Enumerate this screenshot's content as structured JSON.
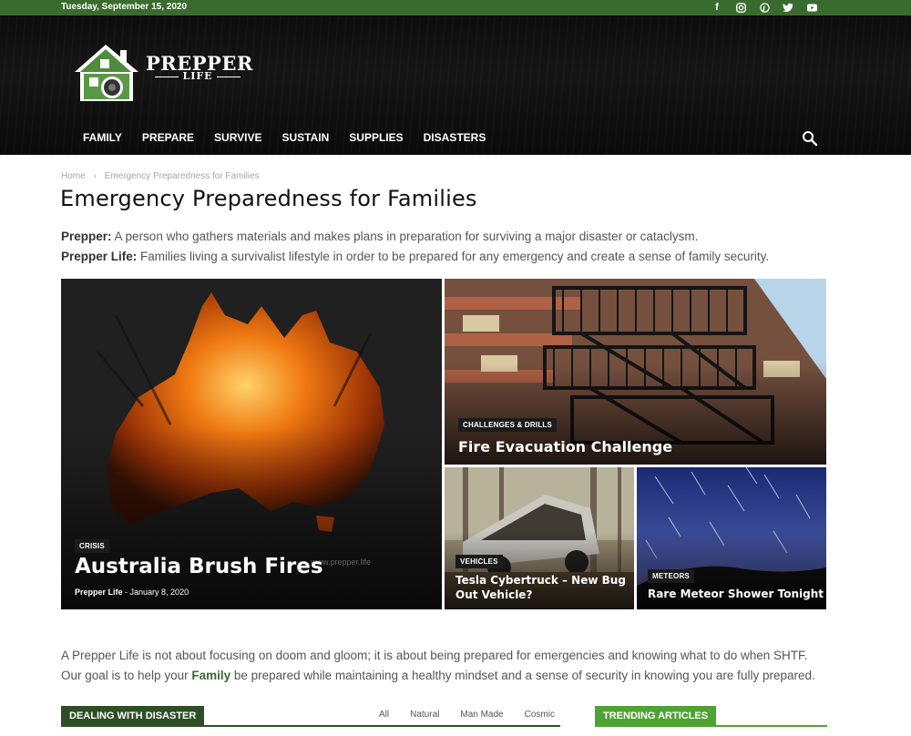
{
  "topbar": {
    "date": "Tuesday, September 15, 2020",
    "social": [
      "facebook-icon",
      "instagram-icon",
      "pinterest-icon",
      "twitter-icon",
      "youtube-icon"
    ]
  },
  "logo": {
    "title": "PREPPER",
    "subtitle": "LIFE"
  },
  "nav": {
    "items": [
      "FAMILY",
      "PREPARE",
      "SURVIVE",
      "SUSTAIN",
      "SUPPLIES",
      "DISASTERS"
    ]
  },
  "breadcrumb": {
    "home": "Home",
    "current": "Emergency Preparedness for Families"
  },
  "page": {
    "title": "Emergency Preparedness for Families",
    "intro1_label": "Prepper:",
    "intro1_text": " A person who gathers materials and makes plans in preparation for surviving a major disaster or cataclysm.",
    "intro2_label": "Prepper Life:",
    "intro2_text": " Families living a survivalist lifestyle in order to be prepared for any emergency and create a sense of family security."
  },
  "tiles": [
    {
      "category": "CRISIS",
      "title": "Australia Brush Fires",
      "author": "Prepper Life",
      "date": "January 8, 2020",
      "watermark": "www.prepper.life"
    },
    {
      "category": "CHALLENGES & DRILLS",
      "title": "Fire Evacuation Challenge"
    },
    {
      "category": "VEHICLES",
      "title": "Tesla Cybertruck – New Bug Out Vehicle?"
    },
    {
      "category": "METEORS",
      "title": "Rare Meteor Shower Tonight"
    }
  ],
  "blurb": {
    "line1": "A Prepper Life is not about focusing on doom and gloom; it is about being prepared for emergencies and knowing what to do when SHTF.",
    "line2_pre": "Our goal is to help your ",
    "line2_link": "Family",
    "line2_post": " be prepared while maintaining a healthy mindset and a sense of security in knowing you are fully prepared."
  },
  "sections": {
    "disaster": {
      "title": "DEALING WITH DISASTER",
      "filters": [
        "All",
        "Natural",
        "Man Made",
        "Cosmic"
      ]
    },
    "trending": {
      "title": "TRENDING ARTICLES"
    }
  },
  "colors": {
    "brand_green": "#3a6b2e",
    "trending_green": "#4fa332",
    "dark_heading": "#2e4f26"
  }
}
